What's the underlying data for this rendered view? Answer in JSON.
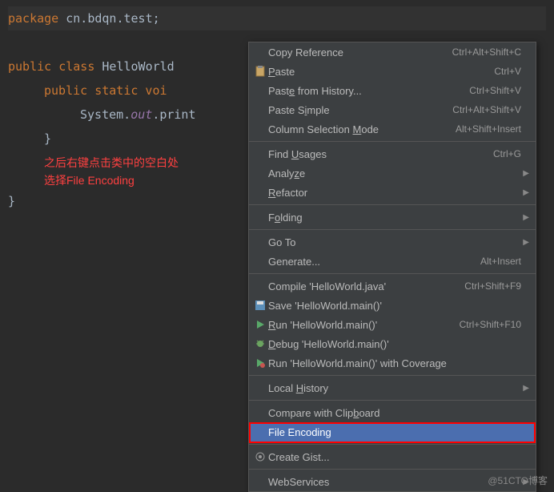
{
  "code": {
    "line1_kw": "package",
    "line1_pkg": " cn.bdqn.test;",
    "line3_kw1": "public class ",
    "line3_cls": "HelloWorld ",
    "line4_kw": "public  static  voi",
    "line5_sys": "System.",
    "line5_out": "out",
    "line5_print": ".print",
    "brace_close": "}",
    "annotation_l1": "之后右键点击类中的空白处",
    "annotation_l2": "选择File Encoding"
  },
  "menu": {
    "copy_reference": "Copy Reference",
    "copy_reference_sc": "Ctrl+Alt+Shift+C",
    "paste": "Paste",
    "paste_sc": "Ctrl+V",
    "paste_history": "Paste from History...",
    "paste_history_sc": "Ctrl+Shift+V",
    "paste_simple": "Paste Simple",
    "paste_simple_sc": "Ctrl+Alt+Shift+V",
    "col_sel": "Column Selection Mode",
    "col_sel_sc": "Alt+Shift+Insert",
    "find_usages": "Find Usages",
    "find_usages_sc": "Ctrl+G",
    "analyze": "Analyze",
    "refactor": "Refactor",
    "folding": "Folding",
    "goto": "Go To",
    "generate": "Generate...",
    "generate_sc": "Alt+Insert",
    "compile": "Compile 'HelloWorld.java'",
    "compile_sc": "Ctrl+Shift+F9",
    "save": "Save 'HelloWorld.main()'",
    "run": "Run 'HelloWorld.main()'",
    "run_sc": "Ctrl+Shift+F10",
    "debug": "Debug 'HelloWorld.main()'",
    "run_cov": "Run 'HelloWorld.main()' with Coverage",
    "local_history": "Local History",
    "compare_clip": "Compare with Clipboard",
    "file_encoding": "File Encoding",
    "create_gist": "Create Gist...",
    "webservices": "WebServices"
  },
  "watermark": "@51CTO博客"
}
